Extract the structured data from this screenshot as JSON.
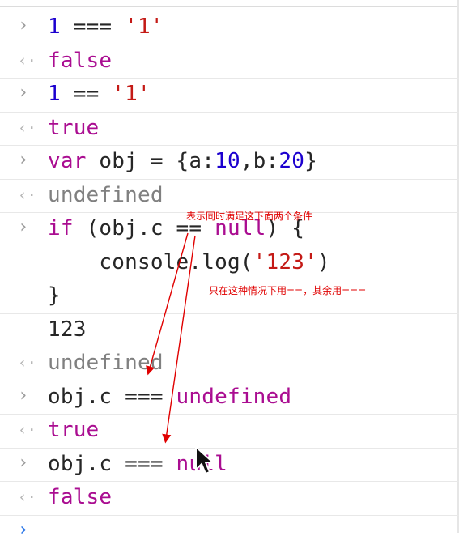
{
  "console": {
    "lines": [
      {
        "type": "input",
        "segments": [
          {
            "t": "1",
            "c": "num"
          },
          {
            "t": " === ",
            "c": "op"
          },
          {
            "t": "'1'",
            "c": "str"
          }
        ]
      },
      {
        "type": "output",
        "segments": [
          {
            "t": "false",
            "c": "kw"
          }
        ]
      },
      {
        "type": "input",
        "segments": [
          {
            "t": "1",
            "c": "num"
          },
          {
            "t": " == ",
            "c": "op"
          },
          {
            "t": "'1'",
            "c": "str"
          }
        ]
      },
      {
        "type": "output",
        "segments": [
          {
            "t": "true",
            "c": "kw"
          }
        ]
      },
      {
        "type": "input",
        "segments": [
          {
            "t": "var",
            "c": "kw"
          },
          {
            "t": " obj = {a:",
            "c": "op"
          },
          {
            "t": "10",
            "c": "num"
          },
          {
            "t": ",b:",
            "c": "op"
          },
          {
            "t": "20",
            "c": "num"
          },
          {
            "t": "}",
            "c": "op"
          }
        ]
      },
      {
        "type": "output",
        "segments": [
          {
            "t": "undefined",
            "c": "gray"
          }
        ]
      },
      {
        "type": "input",
        "multiline": [
          [
            {
              "t": "if",
              "c": "kw"
            },
            {
              "t": " (obj.c == ",
              "c": "op"
            },
            {
              "t": "null",
              "c": "kw"
            },
            {
              "t": ") {",
              "c": "op"
            }
          ],
          [
            {
              "t": "    console.log(",
              "c": "op"
            },
            {
              "t": "'123'",
              "c": "str"
            },
            {
              "t": ")",
              "c": "op"
            }
          ],
          [
            {
              "t": "}",
              "c": "op"
            }
          ]
        ]
      },
      {
        "type": "log",
        "segments": [
          {
            "t": "123",
            "c": "op"
          }
        ]
      },
      {
        "type": "output",
        "segments": [
          {
            "t": "undefined",
            "c": "gray"
          }
        ]
      },
      {
        "type": "input",
        "segments": [
          {
            "t": "obj.c === ",
            "c": "op"
          },
          {
            "t": "undefined",
            "c": "kw"
          }
        ]
      },
      {
        "type": "output",
        "segments": [
          {
            "t": "true",
            "c": "kw"
          }
        ]
      },
      {
        "type": "input",
        "segments": [
          {
            "t": "obj.c === ",
            "c": "op"
          },
          {
            "t": "null",
            "c": "kw"
          }
        ]
      },
      {
        "type": "output",
        "segments": [
          {
            "t": "false",
            "c": "kw"
          }
        ]
      },
      {
        "type": "prompt",
        "segments": []
      }
    ],
    "prefix_input": "›",
    "prefix_output": "‹·"
  },
  "annotations": {
    "note_top": "表示同时满足这下面两个条件",
    "note_mid": "只在这种情况下用==，其余用==="
  },
  "colors": {
    "number": "#1c00cf",
    "string": "#c41a16",
    "keyword": "#aa0d91",
    "muted": "#808080",
    "annotation": "#e00000",
    "prompt_active": "#2a76e8"
  },
  "icons": [
    "chevron-right-icon",
    "return-arrow-icon",
    "mouse-pointer-icon"
  ]
}
